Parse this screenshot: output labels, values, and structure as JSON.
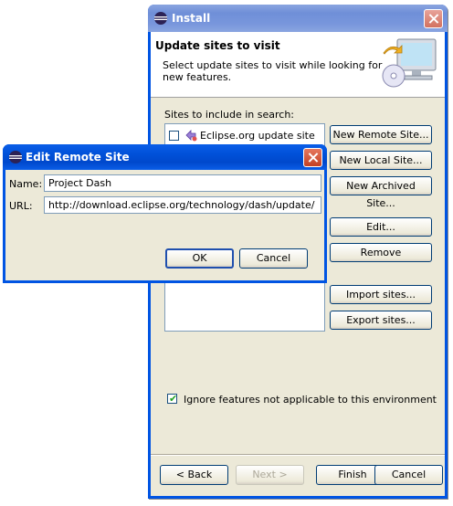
{
  "install": {
    "title": "Install",
    "banner": {
      "heading": "Update sites to visit",
      "description": "Select update sites to visit while looking for new features."
    },
    "sites_label": "Sites to include in search:",
    "sites": [
      {
        "label": "Eclipse.org update site",
        "checked": false
      }
    ],
    "side_buttons": {
      "new_remote": "New Remote Site...",
      "new_local": "New Local Site...",
      "new_archived": "New Archived Site...",
      "edit": "Edit...",
      "remove": "Remove",
      "import": "Import sites...",
      "export": "Export sites..."
    },
    "ignore_label": "Ignore features not applicable to this environment",
    "ignore_checked": true,
    "buttons": {
      "back": "< Back",
      "next": "Next >",
      "finish": "Finish",
      "cancel": "Cancel"
    }
  },
  "edit_dialog": {
    "title": "Edit Remote Site",
    "name_label": "Name:",
    "name_value": "Project Dash",
    "url_label": "URL:",
    "url_value": "http://download.eclipse.org/technology/dash/update/",
    "ok": "OK",
    "cancel": "Cancel"
  },
  "icons": [
    "eclipse-icon",
    "close-icon",
    "update-site-icon",
    "computer-cd-icon",
    "checkmark-icon"
  ],
  "colors": {
    "title_active": "#0054e3",
    "title_inactive": "#7896dc",
    "face": "#ece9d8",
    "check": "#21a121"
  }
}
